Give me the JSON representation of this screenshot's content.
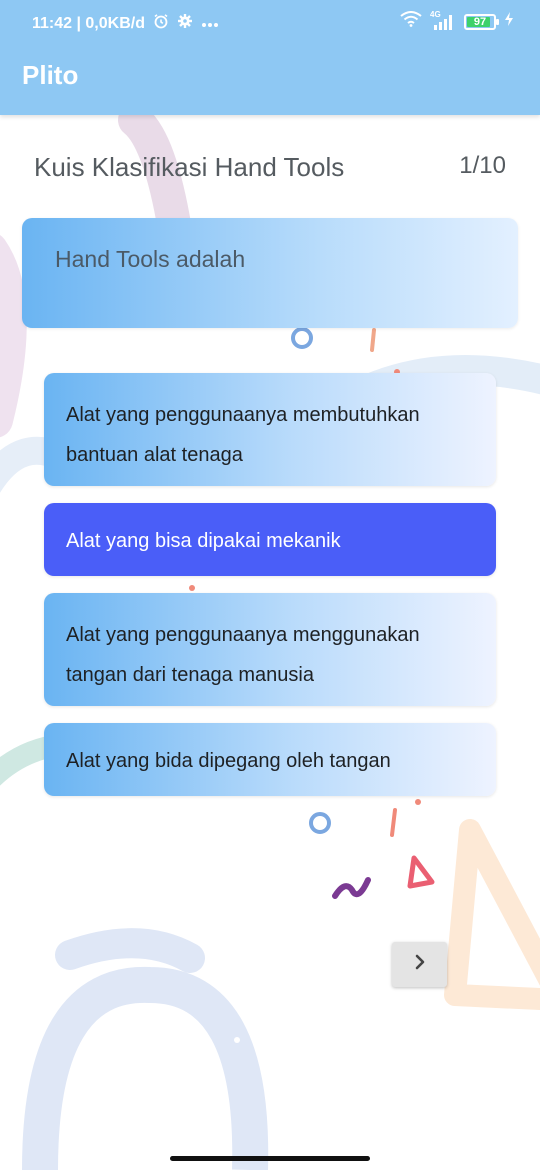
{
  "status_bar": {
    "time_speed": "11:42 | 0,0KB/d",
    "network": "4G",
    "battery": "97"
  },
  "app_bar": {
    "title": "Plito"
  },
  "quiz": {
    "title": "Kuis Klasifikasi Hand Tools",
    "counter": "1/10",
    "question": "Hand Tools adalah",
    "answers": [
      {
        "label": "Alat yang penggunaanya membutuhkan bantuan alat tenaga",
        "selected": false
      },
      {
        "label": "Alat yang bisa dipakai mekanik",
        "selected": true
      },
      {
        "label": "Alat yang penggunaanya menggunakan tangan dari tenaga manusia",
        "selected": false
      },
      {
        "label": "Alat yang bida dipegang oleh tangan",
        "selected": false
      }
    ]
  },
  "icons": {
    "alarm": "alarm-icon",
    "settings": "gear-icon",
    "more": "more-dots-icon",
    "wifi": "wifi-icon",
    "signal": "signal-icon",
    "battery": "battery-icon",
    "charging": "charging-icon",
    "next": "chevron-right-icon"
  },
  "colors": {
    "app_bar": "#8ec8f3",
    "selected_answer": "#4a5ef8",
    "battery_fill": "#3ed16a"
  }
}
